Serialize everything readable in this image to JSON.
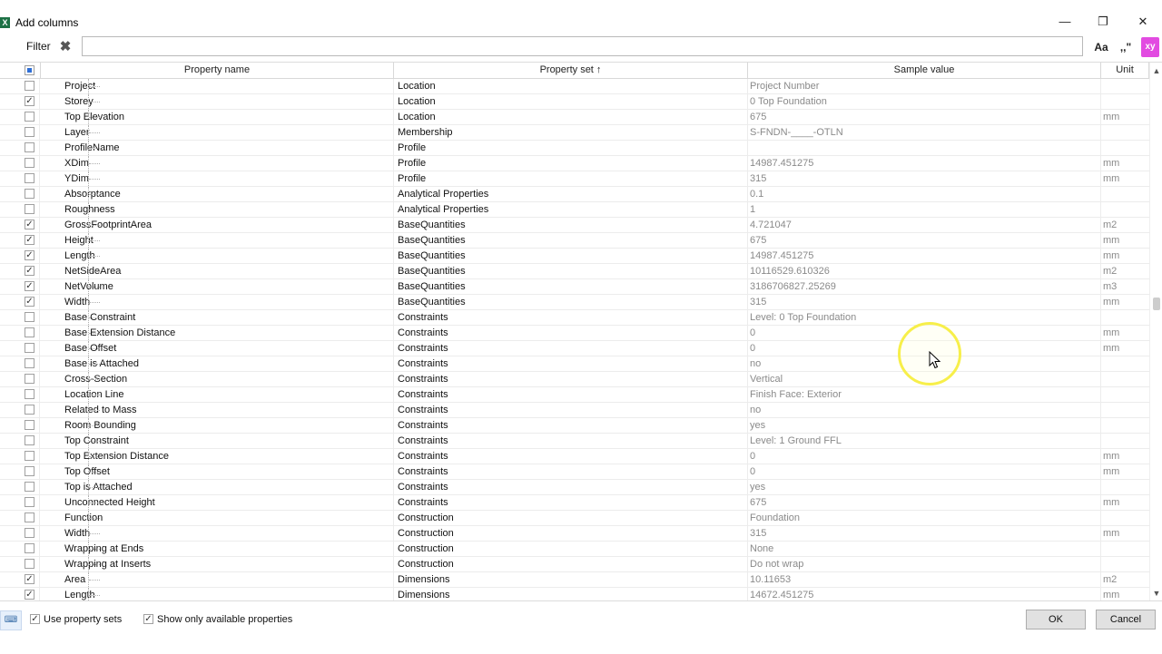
{
  "window": {
    "title": "Add columns",
    "minimize_glyph": "—",
    "restore_glyph": "❐",
    "close_glyph": "✕"
  },
  "filter": {
    "label": "Filter",
    "value": "",
    "placeholder": "",
    "case_label": "Aa",
    "quote_label": ",,\"",
    "xy_label": "xy",
    "xy_color": "#e24be1"
  },
  "table": {
    "columns": [
      "Property name",
      "Property set ↑",
      "Sample value",
      "Unit"
    ],
    "rows": [
      {
        "checked": false,
        "name": "Project",
        "set": "Location",
        "sample": "Project Number",
        "unit": ""
      },
      {
        "checked": true,
        "name": "Storey",
        "set": "Location",
        "sample": "0 Top Foundation",
        "unit": ""
      },
      {
        "checked": false,
        "name": "Top Elevation",
        "set": "Location",
        "sample": "675",
        "unit": "mm"
      },
      {
        "checked": false,
        "name": "Layer",
        "set": "Membership",
        "sample": "S-FNDN-____-OTLN",
        "unit": ""
      },
      {
        "checked": false,
        "name": "ProfileName",
        "set": "Profile",
        "sample": "",
        "unit": ""
      },
      {
        "checked": false,
        "name": "XDim",
        "set": "Profile",
        "sample": "14987.451275",
        "unit": "mm"
      },
      {
        "checked": false,
        "name": "YDim",
        "set": "Profile",
        "sample": "315",
        "unit": "mm"
      },
      {
        "checked": false,
        "name": "Absorptance",
        "set": "Analytical Properties",
        "sample": "0.1",
        "unit": ""
      },
      {
        "checked": false,
        "name": "Roughness",
        "set": "Analytical Properties",
        "sample": "1",
        "unit": ""
      },
      {
        "checked": true,
        "name": "GrossFootprintArea",
        "set": "BaseQuantities",
        "sample": "4.721047",
        "unit": "m2"
      },
      {
        "checked": true,
        "name": "Height",
        "set": "BaseQuantities",
        "sample": "675",
        "unit": "mm"
      },
      {
        "checked": true,
        "name": "Length",
        "set": "BaseQuantities",
        "sample": "14987.451275",
        "unit": "mm"
      },
      {
        "checked": true,
        "name": "NetSideArea",
        "set": "BaseQuantities",
        "sample": "10116529.610326",
        "unit": "m2"
      },
      {
        "checked": true,
        "name": "NetVolume",
        "set": "BaseQuantities",
        "sample": "3186706827.25269",
        "unit": "m3"
      },
      {
        "checked": true,
        "name": "Width",
        "set": "BaseQuantities",
        "sample": "315",
        "unit": "mm"
      },
      {
        "checked": false,
        "name": "Base Constraint",
        "set": "Constraints",
        "sample": "Level: 0 Top Foundation",
        "unit": ""
      },
      {
        "checked": false,
        "name": "Base Extension Distance",
        "set": "Constraints",
        "sample": "0",
        "unit": "mm"
      },
      {
        "checked": false,
        "name": "Base Offset",
        "set": "Constraints",
        "sample": "0",
        "unit": "mm"
      },
      {
        "checked": false,
        "name": "Base is Attached",
        "set": "Constraints",
        "sample": "no",
        "unit": ""
      },
      {
        "checked": false,
        "name": "Cross-Section",
        "set": "Constraints",
        "sample": "Vertical",
        "unit": ""
      },
      {
        "checked": false,
        "name": "Location Line",
        "set": "Constraints",
        "sample": "Finish Face: Exterior",
        "unit": ""
      },
      {
        "checked": false,
        "name": "Related to Mass",
        "set": "Constraints",
        "sample": "no",
        "unit": ""
      },
      {
        "checked": false,
        "name": "Room Bounding",
        "set": "Constraints",
        "sample": "yes",
        "unit": ""
      },
      {
        "checked": false,
        "name": "Top Constraint",
        "set": "Constraints",
        "sample": "Level: 1 Ground FFL",
        "unit": ""
      },
      {
        "checked": false,
        "name": "Top Extension Distance",
        "set": "Constraints",
        "sample": "0",
        "unit": "mm"
      },
      {
        "checked": false,
        "name": "Top Offset",
        "set": "Constraints",
        "sample": "0",
        "unit": "mm"
      },
      {
        "checked": false,
        "name": "Top is Attached",
        "set": "Constraints",
        "sample": "yes",
        "unit": ""
      },
      {
        "checked": false,
        "name": "Unconnected Height",
        "set": "Constraints",
        "sample": "675",
        "unit": "mm"
      },
      {
        "checked": false,
        "name": "Function",
        "set": "Construction",
        "sample": "Foundation",
        "unit": ""
      },
      {
        "checked": false,
        "name": "Width",
        "set": "Construction",
        "sample": "315",
        "unit": "mm"
      },
      {
        "checked": false,
        "name": "Wrapping at Ends",
        "set": "Construction",
        "sample": "None",
        "unit": ""
      },
      {
        "checked": false,
        "name": "Wrapping at Inserts",
        "set": "Construction",
        "sample": "Do not wrap",
        "unit": ""
      },
      {
        "checked": true,
        "name": "Area",
        "set": "Dimensions",
        "sample": "10.11653",
        "unit": "m2"
      },
      {
        "checked": true,
        "name": "Length",
        "set": "Dimensions",
        "sample": "14672.451275",
        "unit": "mm"
      }
    ]
  },
  "footer": {
    "use_property_sets_label": "Use property sets",
    "use_property_sets_checked": true,
    "show_available_label": "Show only available properties",
    "show_available_checked": true,
    "ok_label": "OK",
    "cancel_label": "Cancel"
  }
}
